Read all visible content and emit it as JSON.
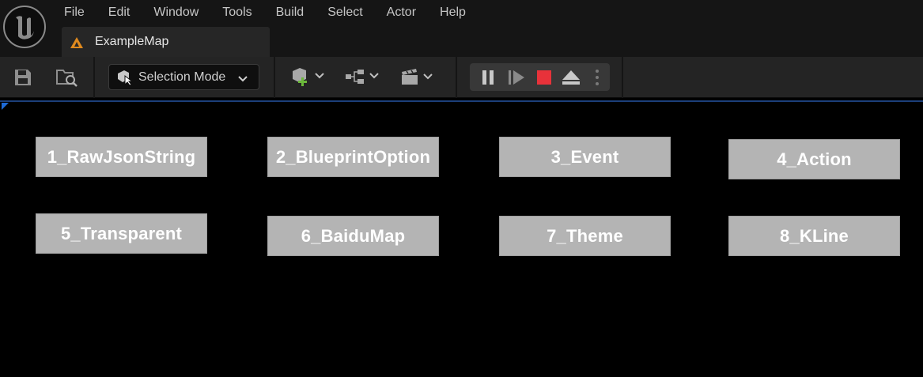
{
  "menu": [
    "File",
    "Edit",
    "Window",
    "Tools",
    "Build",
    "Select",
    "Actor",
    "Help"
  ],
  "tab": {
    "title": "ExampleMap",
    "icon": "level-map-icon"
  },
  "toolbar": {
    "save_icon": "save-icon",
    "browse_icon": "content-browser-icon",
    "mode_label": "Selection Mode",
    "add_actor_icon": "add-actor-icon",
    "blueprint_icon": "blueprint-icon",
    "cinematics_icon": "cinematics-icon",
    "play_controls": [
      "pause-icon",
      "step-icon",
      "stop-icon",
      "eject-icon",
      "more-icon"
    ]
  },
  "buttons": [
    "1_RawJsonString",
    "2_BlueprintOption",
    "3_Event",
    "4_Action",
    "5_Transparent",
    "6_BaiduMap",
    "7_Theme",
    "8_KLine"
  ],
  "colors": {
    "stop": "#e8323a",
    "add_plus": "#6bb83a",
    "accent": "#1e6ad6",
    "map_icon": "#e08a1e"
  }
}
